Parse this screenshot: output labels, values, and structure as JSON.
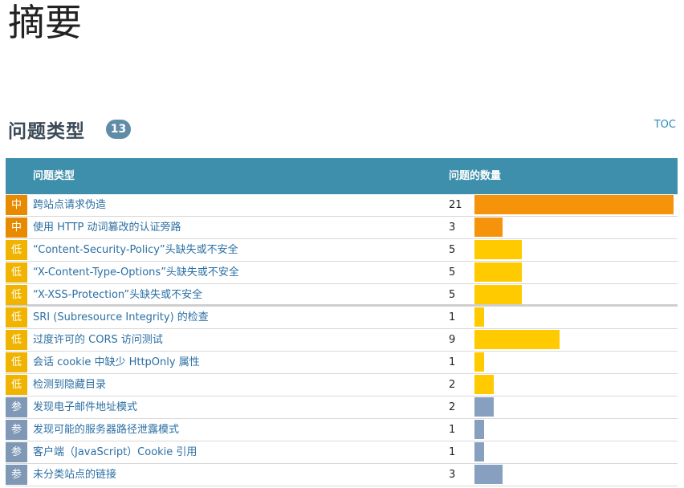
{
  "page": {
    "title": "摘要"
  },
  "section": {
    "title": "问题类型",
    "count": "13",
    "toc_label": "TOC"
  },
  "table": {
    "headers": {
      "type": "问题类型",
      "count": "问题的数量"
    },
    "max_count": 21,
    "rows": [
      {
        "severity": "中",
        "name": "跨站点请求伪造",
        "count": "21",
        "value": 21
      },
      {
        "severity": "中",
        "name": "使用 HTTP 动词篡改的认证旁路",
        "count": "3",
        "value": 3
      },
      {
        "severity": "低",
        "name": "“Content-Security-Policy”头缺失或不安全",
        "count": "5",
        "value": 5
      },
      {
        "severity": "低",
        "name": "“X-Content-Type-Options”头缺失或不安全",
        "count": "5",
        "value": 5
      },
      {
        "severity": "低",
        "name": "“X-XSS-Protection”头缺失或不安全",
        "count": "5",
        "value": 5
      },
      {
        "severity": "低",
        "name": "SRI (Subresource Integrity) 的检查",
        "count": "1",
        "value": 1
      },
      {
        "severity": "低",
        "name": "过度许可的 CORS 访问测试",
        "count": "9",
        "value": 9
      },
      {
        "severity": "低",
        "name": "会话 cookie 中缺少 HttpOnly 属性",
        "count": "1",
        "value": 1
      },
      {
        "severity": "低",
        "name": "检测到隐藏目录",
        "count": "2",
        "value": 2
      },
      {
        "severity": "参",
        "name": "发现电子邮件地址模式",
        "count": "2",
        "value": 2
      },
      {
        "severity": "参",
        "name": "发现可能的服务器路径泄露模式",
        "count": "1",
        "value": 1
      },
      {
        "severity": "参",
        "name": "客户端（JavaScript）Cookie 引用",
        "count": "1",
        "value": 1
      },
      {
        "severity": "参",
        "name": "未分类站点的链接",
        "count": "3",
        "value": 3
      }
    ]
  },
  "colors": {
    "header_bg": "#3e8fac",
    "badge_bg": "#5f8ca8",
    "medium_badge": "#e88a00",
    "medium_bar": "#f5930a",
    "low_badge": "#f0b400",
    "low_bar": "#ffca00",
    "info_badge": "#7e98b6",
    "info_bar": "#87a0c0"
  }
}
